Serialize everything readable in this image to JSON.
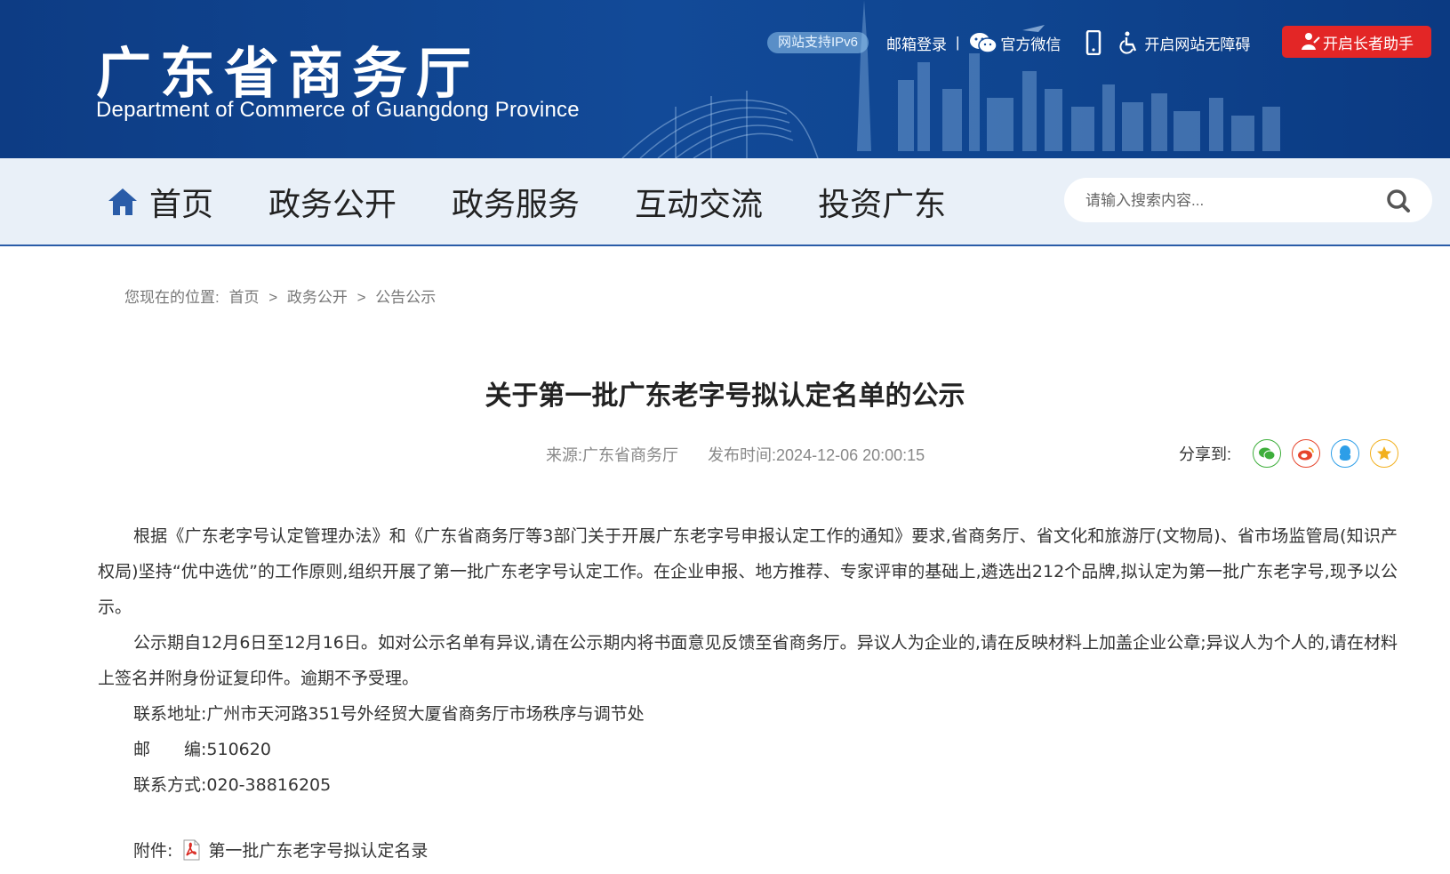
{
  "header": {
    "logo_cn": "广东省商务厅",
    "logo_en": "Department of Commerce of Guangdong Province",
    "ipv6_badge": "网站支持IPv6",
    "mail_login": "邮箱登录",
    "separator": "|",
    "wechat": "官方微信",
    "accessibility": "开启网站无障碍",
    "elder_mode": "开启长者助手"
  },
  "nav": {
    "items": [
      "首页",
      "政务公开",
      "政务服务",
      "互动交流",
      "投资广东"
    ],
    "search_placeholder": "请输入搜索内容..."
  },
  "breadcrumb": {
    "prefix": "您现在的位置:",
    "items": [
      "首页",
      "政务公开",
      "公告公示"
    ],
    "separator": ">"
  },
  "article": {
    "title": "关于第一批广东老字号拟认定名单的公示",
    "source": "来源:广东省商务厅",
    "publish_time": "发布时间:2024-12-06 20:00:15",
    "share_label": "分享到:",
    "paragraphs": [
      "根据《广东老字号认定管理办法》和《广东省商务厅等3部门关于开展广东老字号申报认定工作的通知》要求,省商务厅、省文化和旅游厅(文物局)、省市场监管局(知识产权局)坚持“优中选优”的工作原则,组织开展了第一批广东老字号认定工作。在企业申报、地方推荐、专家评审的基础上,遴选出212个品牌,拟认定为第一批广东老字号,现予以公示。",
      "公示期自12月6日至12月16日。如对公示名单有异议,请在公示期内将书面意见反馈至省商务厅。异议人为企业的,请在反映材料上加盖企业公章;异议人为个人的,请在材料上签名并附身份证复印件。逾期不予受理。"
    ],
    "contact_address": "联系地址:广州市天河路351号外经贸大厦省商务厅市场秩序与调节处",
    "postcode": "邮　　编:510620",
    "phone": "联系方式:020-38816205",
    "attachment_label": "附件:",
    "attachment_name": "第一批广东老字号拟认定名录"
  },
  "colors": {
    "header_bg": "#0f4590",
    "nav_bg": "#e9f0f8",
    "elder_button": "#e32626",
    "wechat_share": "#3dae3a",
    "weibo_share": "#e6452d",
    "qq_share": "#2d9ee8",
    "favorite_share": "#f2b01e"
  }
}
